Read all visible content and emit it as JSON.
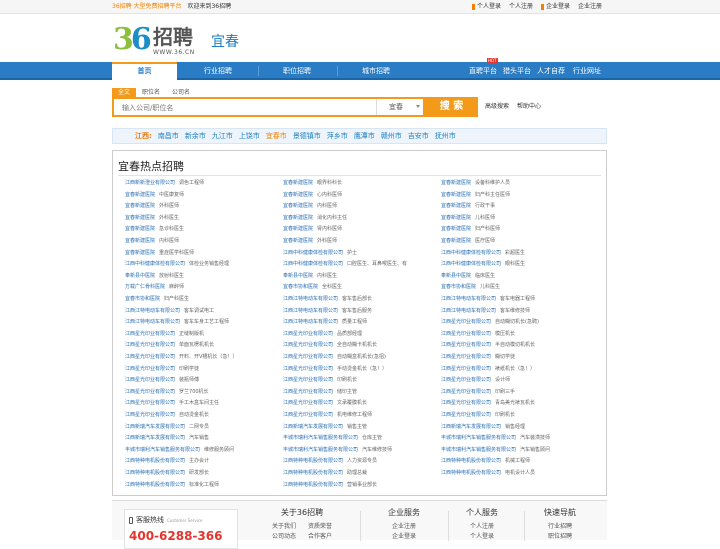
{
  "topbar": {
    "brand": "36招聘 大型免费招聘平台",
    "welcome": "欢迎来到36招聘",
    "links": [
      "个人登录",
      "个人注册",
      "企业登录",
      "企业注册"
    ]
  },
  "logo": {
    "num_a": "3",
    "num_b": "6",
    "text": "招聘",
    "url": "WWW.36.CN"
  },
  "city_name": "宜春",
  "nav": {
    "items": [
      "首页",
      "行业招聘",
      "职位招聘",
      "城市招聘"
    ],
    "right": [
      "直聘平台",
      "猎头平台",
      "人才自荐",
      "行业网址"
    ],
    "badge": "HOT"
  },
  "search": {
    "tabs": [
      "全文",
      "职位名",
      "公司名"
    ],
    "placeholder": "输入公司/职位名",
    "city": "宜春",
    "button": "搜 索",
    "links": [
      "高级搜索",
      "帮助中心"
    ]
  },
  "cities": {
    "label": "江西:",
    "items": [
      "南昌市",
      "新余市",
      "九江市",
      "上饶市",
      "宜春市",
      "景德镇市",
      "萍乡市",
      "鹰潭市",
      "赣州市",
      "吉安市",
      "抚州市"
    ],
    "current": "宜春市"
  },
  "panel": {
    "title": "宜春热点招聘",
    "rows": [
      [
        [
          "江西新新澄业有限公司",
          "调色工程师"
        ],
        [
          "宜春新建医院",
          "眼界科科长"
        ],
        [
          "宜春新建医院",
          "设备科维护人员"
        ]
      ],
      [
        [
          "宜春新建医院",
          "中医康复师"
        ],
        [
          "宜春新建医院",
          "心内科医师"
        ],
        [
          "宜春新建医院",
          "妇产科主任医师"
        ]
      ],
      [
        [
          "宜春新建医院",
          "外科医师"
        ],
        [
          "宜春新建医院",
          "内科医师"
        ],
        [
          "宜春新建医院",
          "行政干事"
        ]
      ],
      [
        [
          "宜春新建医院",
          "外科医生"
        ],
        [
          "宜春新建医院",
          "消化内科主任"
        ],
        [
          "宜春新建医院",
          "儿科医师"
        ]
      ],
      [
        [
          "宜春新建医院",
          "急诊科医生"
        ],
        [
          "宜春新建医院",
          "肾内科医师"
        ],
        [
          "宜春新建医院",
          "妇产科医师"
        ]
      ],
      [
        [
          "宜春新建医院",
          "内科医师"
        ],
        [
          "宜春新建医院",
          "外科医师"
        ],
        [
          "宜春新建医院",
          "医疗医师"
        ]
      ],
      [
        [
          "宜春新建医院",
          "重症医学科医师"
        ],
        [
          "江西中科健康体检有限公司",
          "护士"
        ],
        [
          "江西中科健康体检有限公司",
          "彩超医生"
        ]
      ],
      [
        [
          "江西中科健康体检有限公司",
          "体检业务销售经理"
        ],
        [
          "江西中科健康体检有限公司",
          "口腔医生、耳鼻喉医生、有"
        ],
        [
          "江西中科健康体检有限公司",
          "眼科医生"
        ]
      ],
      [
        [
          "奉新县中医院",
          "放射科医生"
        ],
        [
          "奉新县中医院",
          "内科医生"
        ],
        [
          "奉新县中医院",
          "临床医生"
        ]
      ],
      [
        [
          "万载广仁骨科医院",
          "麻醉师"
        ],
        [
          "宜春市协和医院",
          "全科医生"
        ],
        [
          "宜春市协和医院",
          "儿科医生"
        ]
      ],
      [
        [
          "宜春市协和医院",
          "妇产科医生"
        ],
        [
          "江西江特电动车有限公司",
          "客车售后部长"
        ],
        [
          "江西江特电动车有限公司",
          "客车电器工程师"
        ]
      ],
      [
        [
          "江西江特电动车有限公司",
          "客车调试电工"
        ],
        [
          "江西江特电动车有限公司",
          "客车售后服务"
        ],
        [
          "江西江特电动车有限公司",
          "客车维修技师"
        ]
      ],
      [
        [
          "江西江特电动车有限公司",
          "客车车身工艺工程师"
        ],
        [
          "江西江特电动车有限公司",
          "质量工程师"
        ],
        [
          "江西星光印业有限公司",
          "自动糊切机长(急聘)"
        ]
      ],
      [
        [
          "江西星光印业有限公司",
          "正缝制版机"
        ],
        [
          "江西星光印业有限公司",
          "品质部经理"
        ],
        [
          "江西星光印业有限公司",
          "模压机长"
        ]
      ],
      [
        [
          "江西星光印业有限公司",
          "单面瓦楞机机长"
        ],
        [
          "江西星光印业有限公司",
          "全自动糊卡机机长"
        ],
        [
          "江西星光印业有限公司",
          "半自动模切机机长"
        ]
      ],
      [
        [
          "江西星光印业有限公司",
          "开料、开V槽机长（急！）"
        ],
        [
          "江西星光印业有限公司",
          "自动糊盒机机长(急招)"
        ],
        [
          "江西星光印业有限公司",
          "糊切学徒"
        ]
      ],
      [
        [
          "江西星光印业有限公司",
          "印刷学徒"
        ],
        [
          "江西星光印业有限公司",
          "手动烫金机长（急！）"
        ],
        [
          "江西星光印业有限公司",
          "裱纸机长（急！）"
        ]
      ],
      [
        [
          "江西星光印业有限公司",
          "装瓶师傅"
        ],
        [
          "江西星光印业有限公司",
          "印刷机长"
        ],
        [
          "江西星光印业有限公司",
          "设计师"
        ]
      ],
      [
        [
          "江西星光印业有限公司",
          "罗兰700机长"
        ],
        [
          "江西星光印业有限公司",
          "储印主管"
        ],
        [
          "江西星光印业有限公司",
          "印刷三手"
        ]
      ],
      [
        [
          "江西星光印业有限公司",
          "手工木盒车间主任"
        ],
        [
          "江西星光印业有限公司",
          "文承覆膜机长"
        ],
        [
          "江西星光印业有限公司",
          "青岛美光裱瓦机长"
        ]
      ],
      [
        [
          "江西星光印业有限公司",
          "自动烫金机长"
        ],
        [
          "江西星光印业有限公司",
          "机电维修工程师"
        ],
        [
          "江西星光印业有限公司",
          "印刷机长"
        ]
      ],
      [
        [
          "江西新瑞汽车发展有限公司",
          "二网专员"
        ],
        [
          "江西新瑞汽车发展有限公司",
          "销售主管"
        ],
        [
          "江西新瑞汽车发展有限公司",
          "销售经理"
        ]
      ],
      [
        [
          "江西新瑞汽车发展有限公司",
          "汽车销售"
        ],
        [
          "丰城市瑞利汽车销售服务有限公司",
          "仓库主管"
        ],
        [
          "丰城市瑞利汽车销售服务有限公司",
          "汽车装潢技师"
        ]
      ],
      [
        [
          "丰城市瑞利汽车销售服务有限公司",
          "维修服务顾问"
        ],
        [
          "丰城市瑞利汽车销售服务有限公司",
          "汽车维修技师"
        ],
        [
          "丰城市瑞利汽车销售服务有限公司",
          "汽车销售顾问"
        ]
      ],
      [
        [
          "江西特种电机股份有限公司",
          "主办会计"
        ],
        [
          "江西特种电机股份有限公司",
          "人力资源专员"
        ],
        [
          "江西特种电机股份有限公司",
          "机械工程师"
        ]
      ],
      [
        [
          "江西特种电机股份有限公司",
          "研发部长"
        ],
        [
          "江西特种电机股份有限公司",
          "助理总裁"
        ],
        [
          "江西特种电机股份有限公司",
          "电机设计人员"
        ]
      ],
      [
        [
          "江西特种电机股份有限公司",
          "标准化工程师"
        ],
        [
          "江西特种电机股份有限公司",
          "营销事业部长"
        ],
        [
          "",
          ""
        ]
      ]
    ]
  },
  "footer": {
    "hotline_label": "客服热线",
    "hotline_en": "Customer Service",
    "hotline_number": "400-6288-366",
    "cols": [
      {
        "title": "关于36招聘",
        "links": [
          "关于我们",
          "资质荣誉",
          "公司动态",
          "合作客户"
        ]
      },
      {
        "title": "企业服务",
        "links": [
          "企业注册",
          "企业登录"
        ]
      },
      {
        "title": "个人服务",
        "links": [
          "个人注册",
          "个人登录"
        ]
      },
      {
        "title": "快速导航",
        "links": [
          "行业招聘",
          "职位招聘"
        ]
      }
    ]
  }
}
